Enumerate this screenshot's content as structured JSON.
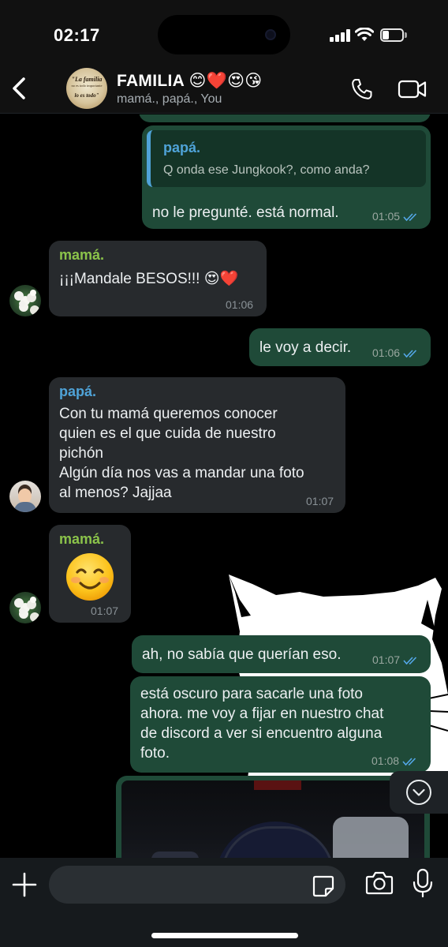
{
  "status_bar": {
    "time": "02:17",
    "signal_icon": "cellular-signal-icon",
    "wifi_icon": "wifi-icon",
    "battery_icon": "battery-icon",
    "battery_level": 0.35
  },
  "header": {
    "back_icon": "chevron-left-icon",
    "avatar": {
      "line1": "\"La familia",
      "line2": "no es todo importante",
      "line3": "lo es todo\""
    },
    "title": "FAMILIA 😊❤️😍😘",
    "members": "mamá., papá., You",
    "call_icon": "phone-icon",
    "video_icon": "video-camera-icon"
  },
  "colors": {
    "outgoing_bubble": "#1f4a38",
    "incoming_bubble": "#272a2d",
    "sender_mama": "#8bc34a",
    "sender_papa": "#4fa3d8",
    "read_ticks": "#53a7e8"
  },
  "messages": [
    {
      "direction": "out",
      "quote": {
        "sender": "papá.",
        "text": "Q onda ese Jungkook?, como anda?"
      },
      "text": "no le pregunté. está normal.",
      "time": "01:05",
      "status": "read"
    },
    {
      "direction": "in",
      "sender": "mamá.",
      "text": "¡¡¡Mandale BESOS!!! 😍❤️",
      "time": "01:06"
    },
    {
      "direction": "out",
      "text": "le voy a decir.",
      "time": "01:06",
      "status": "read"
    },
    {
      "direction": "in",
      "sender": "papá.",
      "text": "Con tu mamá queremos conocer\nquien es el que cuida de nuestro\npichón\nAlgún día nos vas a mandar una foto\nal menos? Jajjaa",
      "time": "01:07"
    },
    {
      "direction": "in",
      "sender": "mamá.",
      "emoji": "smiling-face-emoji",
      "time": "01:07"
    },
    {
      "direction": "out",
      "text": "ah, no sabía que querían eso.",
      "time": "01:07",
      "status": "read"
    },
    {
      "direction": "out",
      "text": "está oscuro para sacarle una foto\nahora. me voy a fijar en nuestro chat\nde discord a ver si encuentro alguna\nfoto.",
      "time": "01:08",
      "status": "read"
    },
    {
      "direction": "out",
      "type": "image"
    }
  ],
  "scroll_down_icon": "chevron-down-circle-icon",
  "input_bar": {
    "plus_icon": "plus-icon",
    "placeholder": "",
    "sticker_icon": "sticker-icon",
    "camera_icon": "camera-icon",
    "mic_icon": "microphone-icon"
  }
}
